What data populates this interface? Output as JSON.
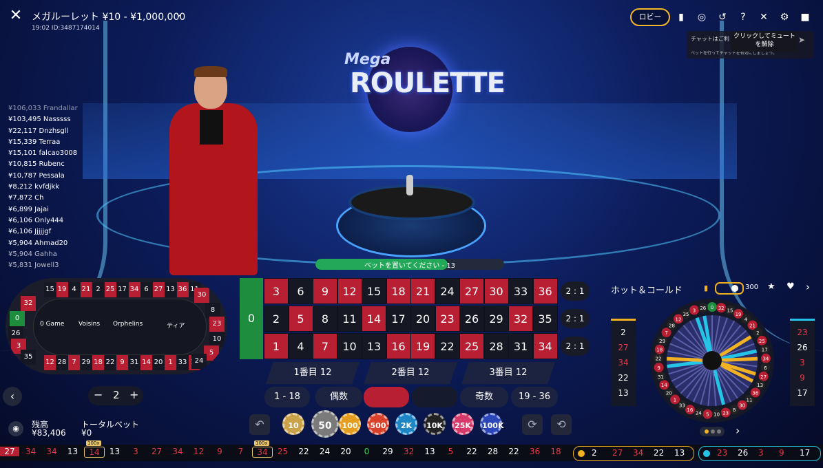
{
  "header": {
    "title": "メガルーレット ¥10 - ¥1,000,000",
    "subtitle": "19:02  ID:3487174014",
    "lobby_label": "ロビー",
    "chat_placeholder": "チャットはご利",
    "chat_note": "ベットを行ってチャットを有効にしましょう。",
    "tooltip": "クリックしてミュートを解除"
  },
  "logo": {
    "mega": "Mega",
    "main": "ROULETTE"
  },
  "winners": [
    "¥106,033 Frandallar",
    "¥103,495 Nasssss",
    "¥22,117 Dnzhsgll",
    "¥15,339 Terraa",
    "¥15,101 falcao3008",
    "¥10,815 Rubenc",
    "¥10,787 Pessala",
    "¥8,212 kvfdjkk",
    "¥7,872 Ch",
    "¥6,899 Jajai",
    "¥6,106 Only444",
    "¥6,106 Jjjjjgf",
    "¥5,904 Ahmad20",
    "¥5,904 Gahha",
    "¥5,831 Jowell3"
  ],
  "status": {
    "text": "ベットを置いてください - 13",
    "progress": 0.7
  },
  "racetrack": {
    "top": [
      {
        "n": "15",
        "c": "b"
      },
      {
        "n": "19",
        "c": "r"
      },
      {
        "n": "4",
        "c": "b"
      },
      {
        "n": "21",
        "c": "r"
      },
      {
        "n": "2",
        "c": "b"
      },
      {
        "n": "25",
        "c": "r"
      },
      {
        "n": "17",
        "c": "b"
      },
      {
        "n": "34",
        "c": "r"
      },
      {
        "n": "6",
        "c": "b"
      },
      {
        "n": "27",
        "c": "r"
      },
      {
        "n": "13",
        "c": "b"
      },
      {
        "n": "36",
        "c": "r"
      },
      {
        "n": "11",
        "c": "b"
      }
    ],
    "bottom": [
      {
        "n": "12",
        "c": "r"
      },
      {
        "n": "28",
        "c": "b"
      },
      {
        "n": "7",
        "c": "r"
      },
      {
        "n": "29",
        "c": "b"
      },
      {
        "n": "18",
        "c": "r"
      },
      {
        "n": "22",
        "c": "b"
      },
      {
        "n": "9",
        "c": "r"
      },
      {
        "n": "31",
        "c": "b"
      },
      {
        "n": "14",
        "c": "r"
      },
      {
        "n": "20",
        "c": "b"
      },
      {
        "n": "1",
        "c": "r"
      },
      {
        "n": "33",
        "c": "b"
      },
      {
        "n": "16",
        "c": "r"
      }
    ],
    "left": [
      {
        "n": "32",
        "c": "r"
      },
      {
        "n": "0",
        "c": "g"
      },
      {
        "n": "26",
        "c": "b"
      },
      {
        "n": "3",
        "c": "r"
      },
      {
        "n": "35",
        "c": "b"
      }
    ],
    "right": [
      {
        "n": "30",
        "c": "r"
      },
      {
        "n": "8",
        "c": "b"
      },
      {
        "n": "23",
        "c": "r"
      },
      {
        "n": "10",
        "c": "b"
      },
      {
        "n": "5",
        "c": "r"
      },
      {
        "n": "24",
        "c": "b"
      }
    ],
    "sections": [
      "0 Game",
      "Voisins",
      "Orphelins",
      "ティア"
    ]
  },
  "stepper": {
    "value": "2",
    "minus": "−",
    "plus": "+"
  },
  "grid": {
    "zero": "0",
    "rows": [
      [
        {
          "n": "3",
          "c": "r"
        },
        {
          "n": "6",
          "c": "b"
        },
        {
          "n": "9",
          "c": "r"
        },
        {
          "n": "12",
          "c": "r"
        },
        {
          "n": "15",
          "c": "b"
        },
        {
          "n": "18",
          "c": "r"
        },
        {
          "n": "21",
          "c": "r"
        },
        {
          "n": "24",
          "c": "b"
        },
        {
          "n": "27",
          "c": "r"
        },
        {
          "n": "30",
          "c": "r"
        },
        {
          "n": "33",
          "c": "b"
        },
        {
          "n": "36",
          "c": "r"
        }
      ],
      [
        {
          "n": "2",
          "c": "b"
        },
        {
          "n": "5",
          "c": "r"
        },
        {
          "n": "8",
          "c": "b"
        },
        {
          "n": "11",
          "c": "b"
        },
        {
          "n": "14",
          "c": "r"
        },
        {
          "n": "17",
          "c": "b"
        },
        {
          "n": "20",
          "c": "b"
        },
        {
          "n": "23",
          "c": "r"
        },
        {
          "n": "26",
          "c": "b"
        },
        {
          "n": "29",
          "c": "b"
        },
        {
          "n": "32",
          "c": "r"
        },
        {
          "n": "35",
          "c": "b"
        }
      ],
      [
        {
          "n": "1",
          "c": "r"
        },
        {
          "n": "4",
          "c": "b"
        },
        {
          "n": "7",
          "c": "r"
        },
        {
          "n": "10",
          "c": "b"
        },
        {
          "n": "13",
          "c": "b"
        },
        {
          "n": "16",
          "c": "r"
        },
        {
          "n": "19",
          "c": "r"
        },
        {
          "n": "22",
          "c": "b"
        },
        {
          "n": "25",
          "c": "r"
        },
        {
          "n": "28",
          "c": "b"
        },
        {
          "n": "31",
          "c": "b"
        },
        {
          "n": "34",
          "c": "r"
        }
      ]
    ],
    "columns": [
      "2 : 1",
      "2 : 1",
      "2 : 1"
    ],
    "dozens": [
      "1番目 12",
      "2番目 12",
      "3番目 12"
    ],
    "outside": [
      "1 - 18",
      "偶数",
      "",
      "",
      "奇数",
      "19 - 36"
    ]
  },
  "chips": [
    {
      "label": "10",
      "color": "#c9a24a"
    },
    {
      "label": "50",
      "color": "#7a7a7a"
    },
    {
      "label": "100",
      "color": "#e59d1e"
    },
    {
      "label": "500",
      "color": "#d9412a"
    },
    {
      "label": "2K",
      "color": "#1f86c6"
    },
    {
      "label": "10K",
      "color": "#222"
    },
    {
      "label": "25K",
      "color": "#d63a6a"
    },
    {
      "label": "100K",
      "color": "#2a46b8"
    }
  ],
  "balance": {
    "label": "残高",
    "value": "¥83,406",
    "total_label": "トータルベット",
    "total_value": "¥0"
  },
  "hotcold": {
    "title": "ホット＆コールド",
    "rounds": "300",
    "hot": [
      "2",
      "27",
      "34",
      "22",
      "13"
    ],
    "cold": [
      "23",
      "26",
      "3",
      "9",
      "17"
    ],
    "wheel_numbers": [
      "0",
      "32",
      "15",
      "19",
      "4",
      "21",
      "2",
      "25",
      "17",
      "34",
      "6",
      "27",
      "13",
      "36",
      "11",
      "30",
      "8",
      "23",
      "10",
      "5",
      "24",
      "16",
      "33",
      "1",
      "20",
      "14",
      "31",
      "9",
      "22",
      "18",
      "29",
      "7",
      "28",
      "12",
      "35",
      "3",
      "26"
    ]
  },
  "history": [
    {
      "n": "27",
      "c": "r",
      "hl": true
    },
    {
      "n": "34",
      "c": "r"
    },
    {
      "n": "34",
      "c": "r"
    },
    {
      "n": "13",
      "c": "b"
    },
    {
      "n": "14",
      "c": "r",
      "badge": "100x"
    },
    {
      "n": "13",
      "c": "b"
    },
    {
      "n": "3",
      "c": "r"
    },
    {
      "n": "27",
      "c": "r"
    },
    {
      "n": "34",
      "c": "r"
    },
    {
      "n": "12",
      "c": "r"
    },
    {
      "n": "9",
      "c": "r"
    },
    {
      "n": "7",
      "c": "r"
    },
    {
      "n": "34",
      "c": "r",
      "badge": "100x"
    },
    {
      "n": "25",
      "c": "r"
    },
    {
      "n": "22",
      "c": "b"
    },
    {
      "n": "24",
      "c": "b"
    },
    {
      "n": "20",
      "c": "b"
    },
    {
      "n": "0",
      "c": "g"
    },
    {
      "n": "29",
      "c": "b"
    },
    {
      "n": "32",
      "c": "r"
    },
    {
      "n": "13",
      "c": "b"
    },
    {
      "n": "5",
      "c": "r"
    },
    {
      "n": "22",
      "c": "b"
    },
    {
      "n": "28",
      "c": "b"
    },
    {
      "n": "22",
      "c": "b"
    },
    {
      "n": "36",
      "c": "r"
    },
    {
      "n": "18",
      "c": "r"
    }
  ],
  "history_hot": [
    "2",
    "27",
    "34",
    "22",
    "13"
  ],
  "history_cold": [
    "23",
    "26",
    "3",
    "9",
    "17"
  ],
  "icons": {
    "close": "close-icon",
    "chevron": "chevron-down-icon",
    "chat": "chat-icon",
    "headset": "headset-icon",
    "history": "history-icon",
    "help": "help-icon",
    "mute": "mute-icon",
    "settings": "gear-icon",
    "video": "video-icon",
    "send": "send-icon",
    "undo": "undo-icon",
    "repeat": "repeat-icon",
    "double": "double-icon",
    "star": "star-icon",
    "heart": "heart-icon",
    "back": "back-chevron-icon",
    "next": "next-chevron-icon",
    "chips": "chip-stack-icon",
    "stats": "bar-chart-icon"
  },
  "colors": {
    "red": "#b91f32",
    "black": "#151722",
    "green": "#1e8e3e",
    "hot": "#f1b123",
    "cold": "#25c4e7",
    "lobby_border": "#f3b828"
  }
}
